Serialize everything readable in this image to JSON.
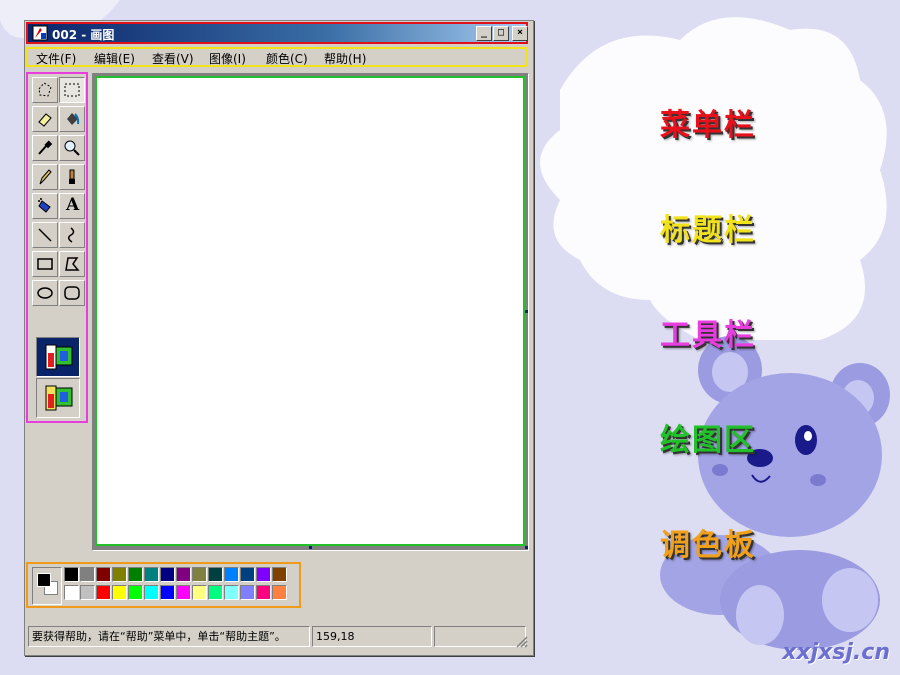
{
  "window": {
    "title": "002 - 画图",
    "buttons": {
      "minimize": "_",
      "maximize": "□",
      "close": "×"
    }
  },
  "menubar": {
    "items": [
      {
        "label": "文件(F)"
      },
      {
        "label": "编辑(E)"
      },
      {
        "label": "查看(V)"
      },
      {
        "label": "图像(I)"
      },
      {
        "label": "颜色(C)"
      },
      {
        "label": "帮助(H)"
      }
    ]
  },
  "toolbox": {
    "tools": [
      {
        "icon": "free-select-icon"
      },
      {
        "icon": "rect-select-icon"
      },
      {
        "icon": "eraser-icon"
      },
      {
        "icon": "fill-bucket-icon"
      },
      {
        "icon": "color-picker-icon"
      },
      {
        "icon": "magnifier-icon"
      },
      {
        "icon": "pencil-icon"
      },
      {
        "icon": "brush-icon"
      },
      {
        "icon": "airbrush-icon"
      },
      {
        "icon": "text-icon",
        "glyph": "A"
      },
      {
        "icon": "line-icon"
      },
      {
        "icon": "curve-icon"
      },
      {
        "icon": "rectangle-icon"
      },
      {
        "icon": "polygon-icon"
      },
      {
        "icon": "ellipse-icon"
      },
      {
        "icon": "rounded-rect-icon"
      }
    ],
    "options": [
      {
        "icon": "opaque-option-icon"
      },
      {
        "icon": "transparent-option-icon"
      }
    ]
  },
  "palette": {
    "foreground": "#000000",
    "background": "#ffffff",
    "top_row": [
      "#000000",
      "#808080",
      "#800000",
      "#808000",
      "#008000",
      "#008080",
      "#000080",
      "#800080",
      "#808040",
      "#004040",
      "#0080ff",
      "#004080",
      "#8000ff",
      "#804000"
    ],
    "bottom_row": [
      "#ffffff",
      "#c0c0c0",
      "#ff0000",
      "#ffff00",
      "#00ff00",
      "#00ffff",
      "#0000ff",
      "#ff00ff",
      "#ffff80",
      "#00ff80",
      "#80ffff",
      "#8080ff",
      "#ff0080",
      "#ff8040"
    ]
  },
  "statusbar": {
    "help_text": "要获得帮助，请在“帮助”菜单中，单击“帮助主题”。",
    "coords": "159,18",
    "size": ""
  },
  "labels": [
    {
      "text": "菜单栏",
      "color": "#e8101a"
    },
    {
      "text": "标题栏",
      "color": "#f2e21a"
    },
    {
      "text": "工具栏",
      "color": "#e83ee0"
    },
    {
      "text": "绘图区",
      "color": "#22c02a"
    },
    {
      "text": "调色板",
      "color": "#f0a01a"
    }
  ],
  "watermark": "xxjxsj.cn"
}
